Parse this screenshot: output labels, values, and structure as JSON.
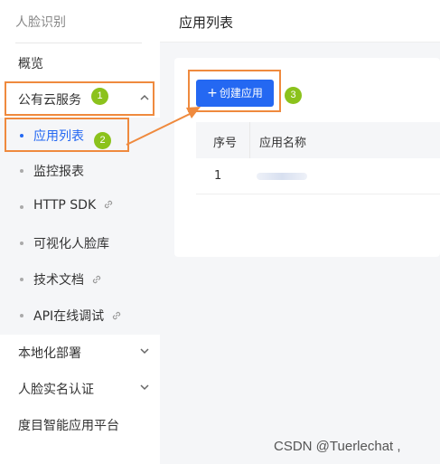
{
  "sidebar": {
    "title": "人脸识别",
    "items": [
      {
        "label": "概览"
      },
      {
        "label": "公有云服务"
      },
      {
        "label": "本地化部署"
      },
      {
        "label": "人脸实名认证"
      },
      {
        "label": "度目智能应用平台"
      }
    ],
    "sub_items": [
      {
        "label": "应用列表"
      },
      {
        "label": "监控报表"
      },
      {
        "label": "HTTP SDK"
      },
      {
        "label": "可视化人脸库"
      },
      {
        "label": "技术文档"
      },
      {
        "label": "API在线调试"
      }
    ]
  },
  "header": {
    "title": "应用列表"
  },
  "main": {
    "create_button": "创建应用",
    "create_button_icon": "+",
    "table": {
      "columns": [
        "序号",
        "应用名称"
      ],
      "rows": [
        {
          "seq": "1"
        }
      ]
    }
  },
  "annotations": [
    "1",
    "2",
    "3"
  ],
  "watermark": "CSDN @Tuerlechat ,",
  "colors": {
    "accent": "#2468f2",
    "annotation": "#ef8a3e",
    "badge": "#8bc21c"
  }
}
